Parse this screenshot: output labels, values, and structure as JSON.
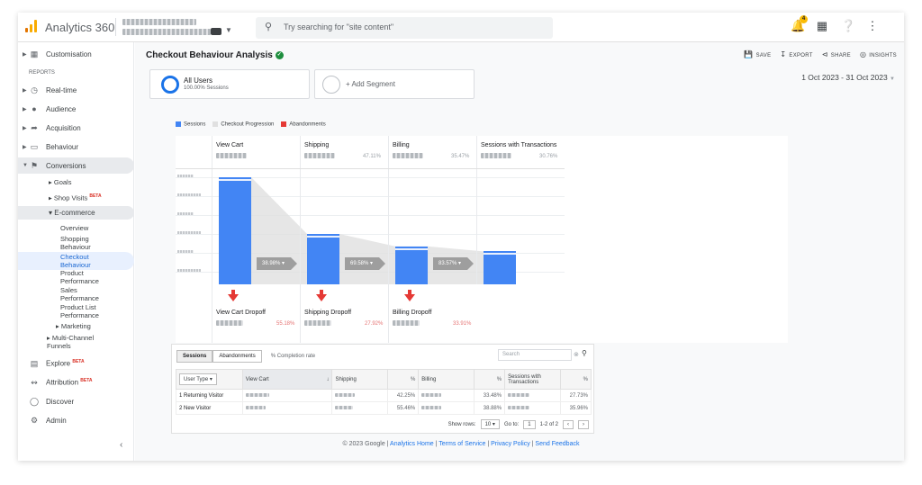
{
  "app": {
    "title": "Analytics 360"
  },
  "search": {
    "placeholder": "Try searching for \"site content\""
  },
  "notifications": {
    "count": "4"
  },
  "sidebar": {
    "customisation": "Customisation",
    "reports_heading": "REPORTS",
    "realtime": "Real-time",
    "audience": "Audience",
    "acquisition": "Acquisition",
    "behaviour": "Behaviour",
    "conversions": "Conversions",
    "goals": "Goals",
    "shop_visits": "Shop Visits",
    "ecommerce": "E-commerce",
    "overview": "Overview",
    "shopping_behaviour": "Shopping Behaviour",
    "checkout_behaviour": "Checkout Behaviour",
    "product_performance": "Product Performance",
    "sales_performance": "Sales Performance",
    "product_list_performance": "Product List Performance",
    "marketing": "Marketing",
    "multi_channel": "Multi-Channel Funnels",
    "explore": "Explore",
    "attribution": "Attribution",
    "discover": "Discover",
    "admin": "Admin",
    "beta": "BETA"
  },
  "report": {
    "title": "Checkout Behaviour Analysis",
    "actions": {
      "save": "SAVE",
      "export": "EXPORT",
      "share": "SHARE",
      "insights": "INSIGHTS"
    },
    "date_range": "1 Oct 2023 - 31 Oct 2023",
    "segments": {
      "all_users": "All Users",
      "all_users_sub": "100.00% Sessions",
      "add": "+ Add Segment"
    },
    "legend": {
      "sessions": "Sessions",
      "progression": "Checkout Progression",
      "abandonments": "Abandonments"
    },
    "colors": {
      "sessions": "#4285f4",
      "progression": "#e0e0e0",
      "abandonments": "#e53935"
    }
  },
  "funnel": {
    "stages": [
      {
        "name": "View Cart",
        "pct": ""
      },
      {
        "name": "Shipping",
        "pct": "47.11%"
      },
      {
        "name": "Billing",
        "pct": "35.47%"
      },
      {
        "name": "Sessions with Transactions",
        "pct": "30.76%"
      }
    ],
    "relative_levels": [
      1.0,
      0.4711,
      0.3547,
      0.3076
    ],
    "conversions": [
      "38.98%",
      "69.58%",
      "83.57%"
    ],
    "dropoffs": [
      {
        "name": "View Cart Dropoff",
        "pct": "55.18%"
      },
      {
        "name": "Shipping Dropoff",
        "pct": "27.92%"
      },
      {
        "name": "Billing Dropoff",
        "pct": "33.91%"
      }
    ]
  },
  "table": {
    "tabs": {
      "sessions": "Sessions",
      "abandonments": "Abandonments",
      "completion": "% Completion rate"
    },
    "search_placeholder": "Search",
    "headers": {
      "user_type": "User Type",
      "view_cart": "View Cart",
      "shipping": "Shipping",
      "pct": "%",
      "billing": "Billing",
      "transactions": "Sessions with Transactions"
    },
    "rows": [
      {
        "label": "1  Returning Visitor",
        "ship_pct": "42.25%",
        "bill_pct": "33.48%",
        "tx_pct": "27.73%"
      },
      {
        "label": "2  New Visitor",
        "ship_pct": "55.46%",
        "bill_pct": "38.88%",
        "tx_pct": "35.96%"
      }
    ],
    "pager": {
      "show_rows": "Show rows:",
      "rows_value": "10",
      "go_to": "Go to:",
      "page": "1",
      "range": "1-2 of 2"
    }
  },
  "footer": {
    "copyright": "© 2023 Google |",
    "home": "Analytics Home",
    "terms": "Terms of Service",
    "privacy": "Privacy Policy",
    "feedback": "Send Feedback"
  }
}
